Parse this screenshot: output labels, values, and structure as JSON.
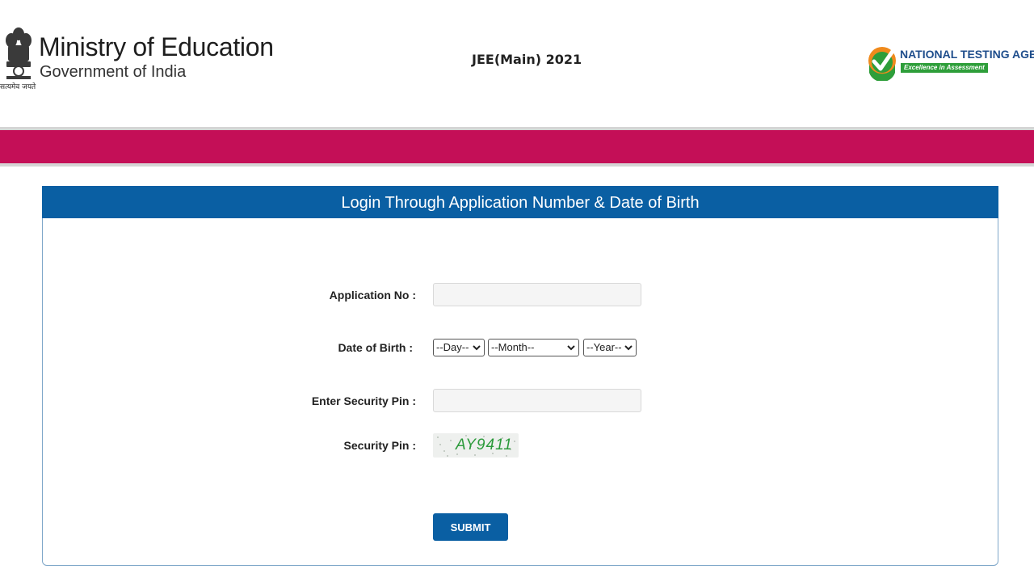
{
  "header": {
    "ministry_title": "Ministry of Education",
    "ministry_subtitle": "Government of India",
    "emblem_motto": "सत्यमेव जयते",
    "exam_title": "JEE(Main) 2021",
    "agency_name": "NATIONAL TESTING AGENCY",
    "agency_tagline": "Excellence in Assessment"
  },
  "colors": {
    "band": "#c40f57",
    "panel_header": "#0a5fa3",
    "captcha_text": "#2b9a3a"
  },
  "icons": [
    "national-emblem-icon",
    "nta-check-icon",
    "chevron-down-icon"
  ],
  "login": {
    "title": "Login Through Application Number & Date of Birth",
    "application_label": "Application No :",
    "application_value": "",
    "dob_label": "Date of Birth :",
    "dob_day": "--Day--",
    "dob_month": "--Month--",
    "dob_year": "--Year--",
    "pin_input_label": "Enter Security Pin :",
    "pin_input_value": "",
    "pin_label": "Security Pin :",
    "pin_code": "AY9411",
    "submit_label": "SUBMIT"
  }
}
